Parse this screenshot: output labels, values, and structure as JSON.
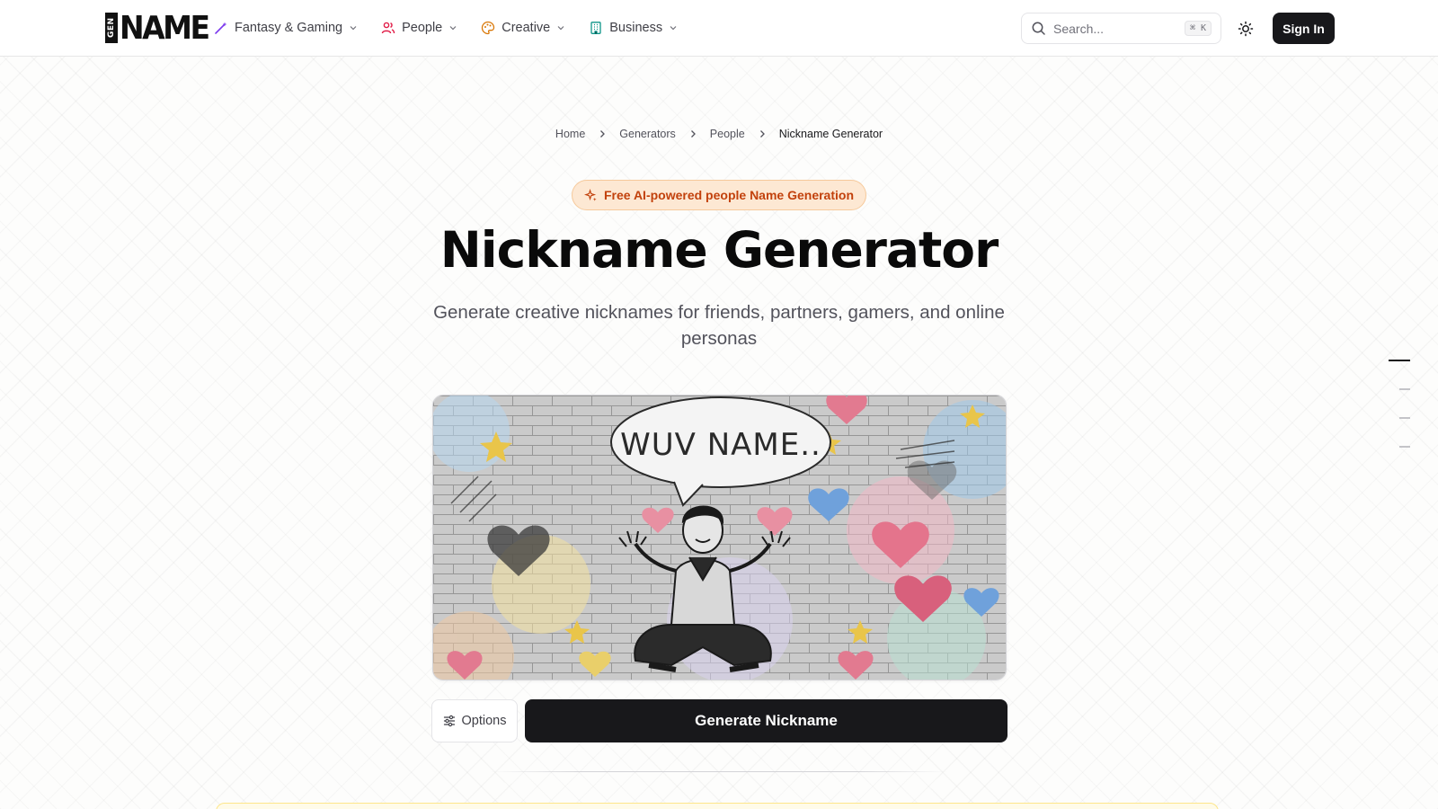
{
  "header": {
    "logo": {
      "small_text": "GEN",
      "main_text": "NAME"
    },
    "nav": [
      {
        "label": "Fantasy & Gaming",
        "icon": "wand-icon",
        "color": "#7c3aed"
      },
      {
        "label": "People",
        "icon": "users-icon",
        "color": "#e11d48"
      },
      {
        "label": "Creative",
        "icon": "palette-icon",
        "color": "#d97706"
      },
      {
        "label": "Business",
        "icon": "building-icon",
        "color": "#0d9488"
      }
    ],
    "search": {
      "placeholder": "Search...",
      "shortcut": "⌘ K"
    },
    "theme_icon": "sun-icon",
    "sign_in_label": "Sign In"
  },
  "breadcrumb": [
    {
      "label": "Home"
    },
    {
      "label": "Generators"
    },
    {
      "label": "People"
    },
    {
      "label": "Nickname Generator",
      "current": true
    }
  ],
  "badge": {
    "label": "Free AI-powered people Name Generation",
    "icon": "sparkle-icon"
  },
  "hero": {
    "title": "Nickname Generator",
    "subtitle": "Generate creative nicknames for friends, partners, gamers, and online personas",
    "image": {
      "speech_bubble_text": "WUV NAME..",
      "description_icon": "illustration"
    }
  },
  "controls": {
    "options_label": "Options",
    "options_icon": "sliders-icon",
    "generate_label": "Generate Nickname"
  },
  "colors": {
    "accent_dark": "#18181b",
    "badge_bg": "#fde8d3",
    "badge_text": "#c2410c"
  },
  "section_nav": {
    "count": 4,
    "active_index": 0
  }
}
